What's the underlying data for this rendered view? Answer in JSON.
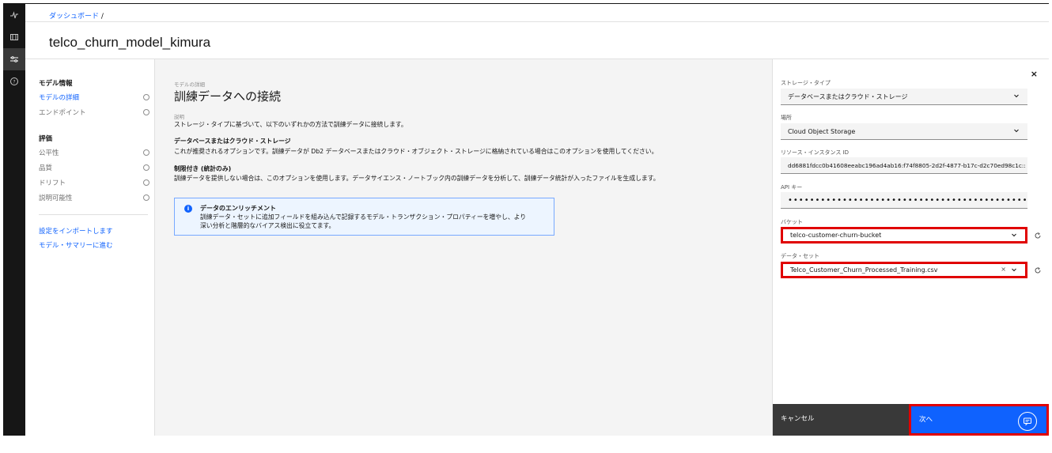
{
  "breadcrumb": {
    "link": "ダッシュボード",
    "sep": "/"
  },
  "page_title": "telco_churn_model_kimura",
  "rail": {
    "icons": [
      "activity-icon",
      "layout-icon",
      "settings-adjust-icon",
      "help-icon"
    ]
  },
  "leftnav": {
    "section1": "モデル情報",
    "item_details": "モデルの詳細",
    "item_endpoints": "エンドポイント",
    "section2": "評価",
    "item_fairness": "公平性",
    "item_quality": "品質",
    "item_drift": "ドリフト",
    "item_explain": "説明可能性",
    "link_import": "設定をインポートします",
    "link_summary": "モデル・サマリーに進む"
  },
  "main": {
    "small_label": "モデルの詳細",
    "title": "訓練データへの接続",
    "desc_label": "説明",
    "desc": "ストレージ・タイプに基づいて、以下のいずれかの方法で訓練データに接続します。",
    "opt1_title": "データベースまたはクラウド・ストレージ",
    "opt1_body": "これが推奨されるオプションです。訓練データが Db2 データベースまたはクラウド・オブジェクト・ストレージに格納されている場合はこのオプションを使用してください。",
    "opt2_title": "制限付き (統計のみ)",
    "opt2_body": "訓練データを提供しない場合は、このオプションを使用します。データサイエンス・ノートブック内の訓練データを分析して、訓練データ統計が入ったファイルを生成します。",
    "notice_title": "データのエンリッチメント",
    "notice_line1": "訓練データ・セットに追加フィールドを組み込んで記録するモデル・トランザクション・プロパティーを増やし、より",
    "notice_line2": "深い分析と階層的なバイアス検出に役立てます。"
  },
  "panel": {
    "storage_label": "ストレージ・タイプ",
    "storage_value": "データベースまたはクラウド・ストレージ",
    "location_label": "場所",
    "location_value": "Cloud Object Storage",
    "resource_label": "リソース・インスタンス ID",
    "resource_value": "dd6881fdcc0b41608eeabc196ad4ab16:f74f8805-2d2f-4877-b17c-d2c70ed98c1c::",
    "api_label": "API キー",
    "api_value": "•••••••••••••••••••••••••••••••••••••••••••••",
    "bucket_label": "バケット",
    "bucket_value": "telco-customer-churn-bucket",
    "dataset_label": "データ・セット",
    "dataset_value": "Telco_Customer_Churn_Processed_Training.csv",
    "clear": "×",
    "close": "×",
    "cancel": "キャンセル",
    "next": "次へ"
  },
  "colors": {
    "accent": "#0f62fe",
    "highlight": "#e00000",
    "rail": "#161616"
  }
}
